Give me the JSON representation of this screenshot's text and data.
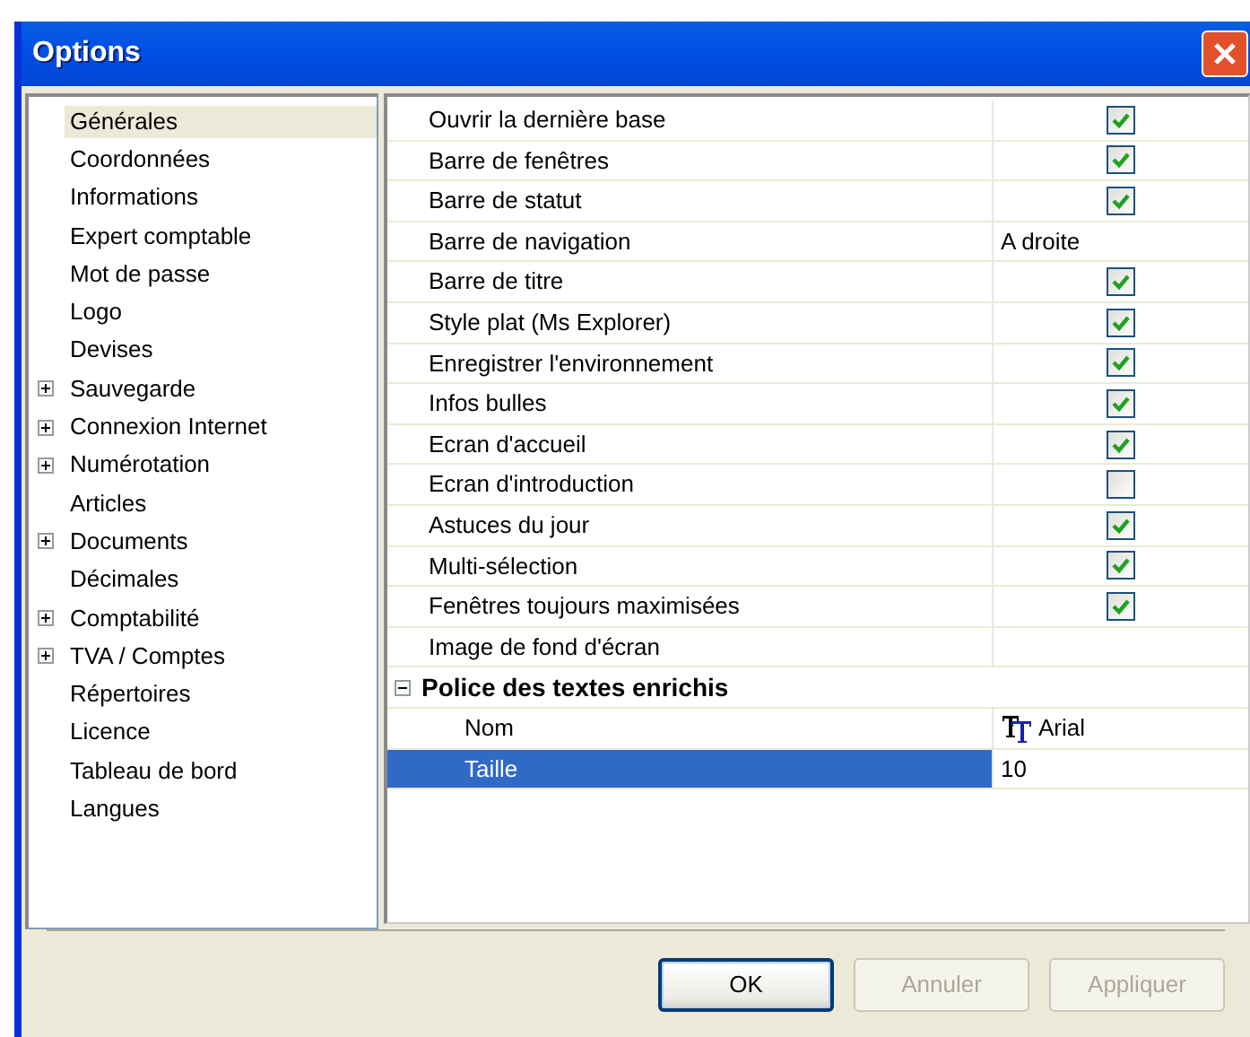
{
  "window": {
    "title": "Options"
  },
  "sidebar": {
    "items": [
      {
        "label": "Générales",
        "selected": true,
        "expandable": false
      },
      {
        "label": "Coordonnées",
        "selected": false,
        "expandable": false
      },
      {
        "label": "Informations",
        "selected": false,
        "expandable": false
      },
      {
        "label": "Expert comptable",
        "selected": false,
        "expandable": false
      },
      {
        "label": "Mot de passe",
        "selected": false,
        "expandable": false
      },
      {
        "label": "Logo",
        "selected": false,
        "expandable": false
      },
      {
        "label": "Devises",
        "selected": false,
        "expandable": false
      },
      {
        "label": "Sauvegarde",
        "selected": false,
        "expandable": true
      },
      {
        "label": "Connexion Internet",
        "selected": false,
        "expandable": true
      },
      {
        "label": "Numérotation",
        "selected": false,
        "expandable": true
      },
      {
        "label": "Articles",
        "selected": false,
        "expandable": false
      },
      {
        "label": "Documents",
        "selected": false,
        "expandable": true
      },
      {
        "label": "Décimales",
        "selected": false,
        "expandable": false
      },
      {
        "label": "Comptabilité",
        "selected": false,
        "expandable": true
      },
      {
        "label": "TVA / Comptes",
        "selected": false,
        "expandable": true
      },
      {
        "label": "Répertoires",
        "selected": false,
        "expandable": false
      },
      {
        "label": "Licence",
        "selected": false,
        "expandable": false
      },
      {
        "label": "Tableau de bord",
        "selected": false,
        "expandable": false
      },
      {
        "label": "Langues",
        "selected": false,
        "expandable": false
      }
    ]
  },
  "properties": [
    {
      "kind": "checkbox",
      "label": "Ouvrir la dernière base",
      "checked": true,
      "selected": false
    },
    {
      "kind": "checkbox",
      "label": "Barre de fenêtres",
      "checked": true,
      "selected": false
    },
    {
      "kind": "checkbox",
      "label": "Barre de statut",
      "checked": true,
      "selected": false
    },
    {
      "kind": "text",
      "label": "Barre de navigation",
      "value": "A droite",
      "selected": false
    },
    {
      "kind": "checkbox",
      "label": "Barre de titre",
      "checked": true,
      "selected": false
    },
    {
      "kind": "checkbox",
      "label": "Style plat (Ms Explorer)",
      "checked": true,
      "selected": false
    },
    {
      "kind": "checkbox",
      "label": "Enregistrer l'environnement",
      "checked": true,
      "selected": false
    },
    {
      "kind": "checkbox",
      "label": "Infos bulles",
      "checked": true,
      "selected": false
    },
    {
      "kind": "checkbox",
      "label": "Ecran d'accueil",
      "checked": true,
      "selected": false
    },
    {
      "kind": "checkbox",
      "label": "Ecran d'introduction",
      "checked": false,
      "selected": false
    },
    {
      "kind": "checkbox",
      "label": "Astuces du jour",
      "checked": true,
      "selected": false
    },
    {
      "kind": "checkbox",
      "label": "Multi-sélection",
      "checked": true,
      "selected": false
    },
    {
      "kind": "checkbox",
      "label": "Fenêtres toujours maximisées",
      "checked": true,
      "selected": false
    },
    {
      "kind": "empty",
      "label": "Image de fond d'écran",
      "selected": false
    },
    {
      "kind": "group",
      "label": "Police des textes enrichis",
      "expanded": true,
      "selected": false,
      "children": [
        {
          "kind": "font",
          "label": "Nom",
          "value": "Arial",
          "selected": false
        },
        {
          "kind": "text",
          "label": "Taille",
          "value": "10",
          "selected": true
        }
      ]
    }
  ],
  "buttons": [
    {
      "label": "OK",
      "default": true,
      "disabled": false
    },
    {
      "label": "Annuler",
      "default": false,
      "disabled": true
    },
    {
      "label": "Appliquer",
      "default": false,
      "disabled": true
    }
  ]
}
